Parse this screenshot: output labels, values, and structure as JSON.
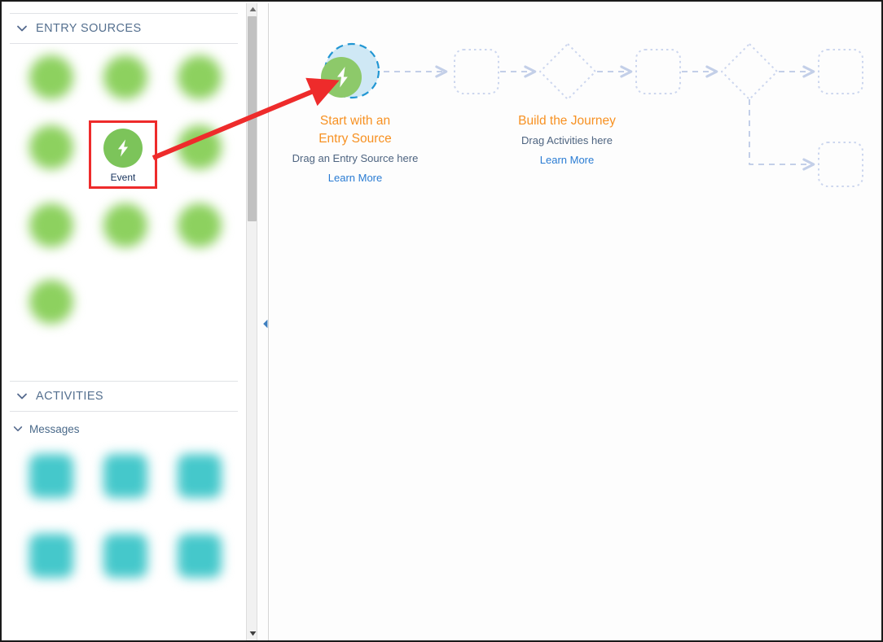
{
  "sidebar": {
    "sections": [
      {
        "id": "entry-sources",
        "label": "ENTRY SOURCES",
        "chevron_icon": "chevron-down-icon"
      },
      {
        "id": "activities",
        "label": "ACTIVITIES",
        "chevron_icon": "chevron-down-icon"
      }
    ],
    "subsections": [
      {
        "id": "messages",
        "label": "Messages",
        "chevron_icon": "chevron-down-icon"
      }
    ],
    "entry_sources": {
      "selected_tile": {
        "label": "Event",
        "icon": "lightning-bolt-icon",
        "color": "#7cc45a",
        "highlight_color": "#ee2b2b"
      },
      "placeholder_tiles_row1": [
        {
          "label": "",
          "icon": "entry-source-icon",
          "color": "#8dd15f"
        },
        {
          "label": "",
          "icon": "entry-source-icon",
          "color": "#8dd15f"
        },
        {
          "label": "",
          "icon": "entry-source-icon",
          "color": "#8dd15f"
        }
      ],
      "placeholder_tiles_row2": [
        {
          "label": "",
          "icon": "entry-source-icon",
          "color": "#8dd15f"
        },
        {
          "label": "",
          "icon": "entry-source-icon",
          "color": "#8dd15f"
        }
      ],
      "placeholder_tiles_row3": [
        {
          "label": "",
          "icon": "entry-source-icon",
          "color": "#8dd15f"
        },
        {
          "label": "",
          "icon": "entry-source-icon",
          "color": "#8dd15f"
        },
        {
          "label": "",
          "icon": "entry-source-icon",
          "color": "#8dd15f"
        }
      ],
      "placeholder_tiles_row4": [
        {
          "label": "",
          "icon": "entry-source-icon",
          "color": "#8dd15f"
        }
      ]
    },
    "activities": {
      "placeholder_tiles_row1": [
        {
          "label": "",
          "icon": "activity-icon",
          "color": "#45c8cb"
        },
        {
          "label": "",
          "icon": "activity-icon",
          "color": "#45c8cb"
        },
        {
          "label": "",
          "icon": "activity-icon",
          "color": "#45c8cb"
        }
      ],
      "placeholder_tiles_row2": [
        {
          "label": "",
          "icon": "activity-icon",
          "color": "#45c8cb"
        },
        {
          "label": "",
          "icon": "activity-icon",
          "color": "#45c8cb"
        },
        {
          "label": "",
          "icon": "activity-icon",
          "color": "#45c8cb"
        }
      ]
    },
    "scrollbar": {
      "up_arrow_icon": "triangle-up-icon",
      "down_arrow_icon": "triangle-down-icon",
      "thumb": "scroll-thumb"
    },
    "collapse_handle_icon": "chevron-left-icon"
  },
  "canvas": {
    "entry_source_node": {
      "title_line1": "Start with an",
      "title_line2": "Entry Source",
      "subtitle": "Drag an Entry Source here",
      "link": "Learn More",
      "icon": "lightning-bolt-icon",
      "dropzone_fill": "#cfe8f5",
      "dropzone_border": "#2196d3",
      "badge_color": "#8dc96a"
    },
    "journey_node": {
      "title": "Build the Journey",
      "subtitle": "Drag Activities here",
      "link": "Learn More"
    },
    "placeholder_shapes": [
      {
        "type": "rounded-rect",
        "id": "activity-placeholder-1"
      },
      {
        "type": "diamond",
        "id": "decision-placeholder-1"
      },
      {
        "type": "rounded-rect",
        "id": "activity-placeholder-2"
      },
      {
        "type": "diamond",
        "id": "decision-placeholder-2"
      },
      {
        "type": "rounded-rect",
        "id": "activity-placeholder-3"
      },
      {
        "type": "rounded-rect",
        "id": "activity-placeholder-4"
      }
    ],
    "colors": {
      "placeholder_stroke": "#ccd6ee",
      "connector_stroke": "#c3cfe8",
      "title_orange": "#f79122",
      "subtitle_slate": "#4e6480",
      "link_blue": "#2a7cd3"
    }
  },
  "annotation": {
    "arrow": {
      "icon": "red-pointer-arrow",
      "color": "#ee2b2b",
      "from": "Event",
      "to": "Start with an Entry Source"
    }
  }
}
